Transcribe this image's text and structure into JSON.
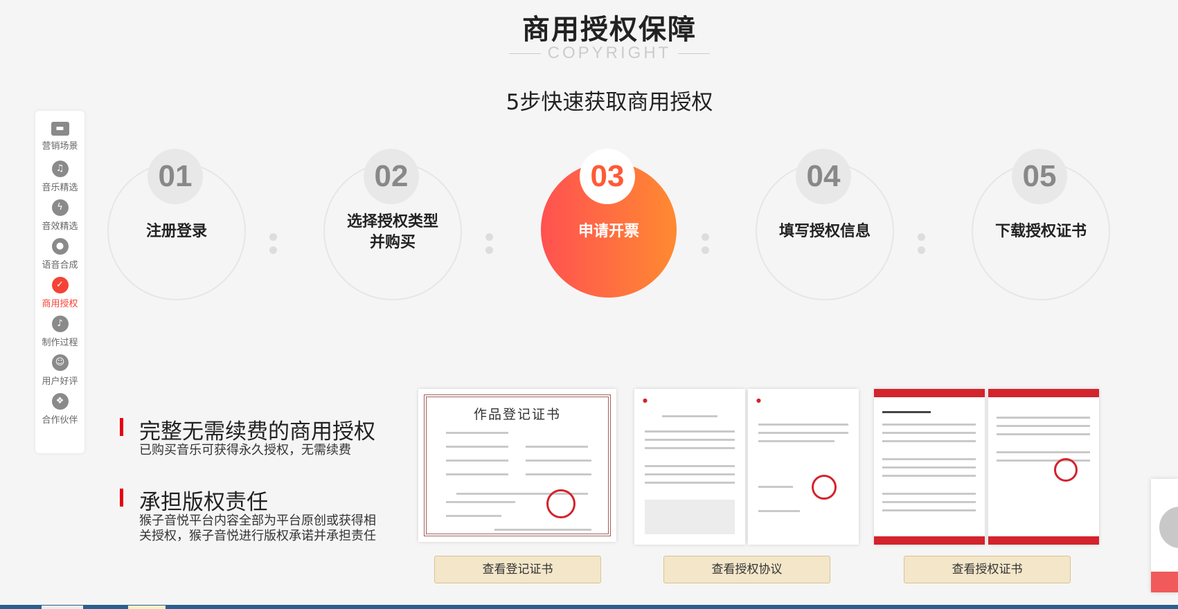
{
  "header": {
    "title": "商用授权保障",
    "subtitle": "COPYRIGHT",
    "steps_title": "5步快速获取商用授权"
  },
  "sidenav": {
    "items": [
      {
        "label": "营销场景",
        "icon": "clapperboard-icon",
        "active": false
      },
      {
        "label": "音乐精选",
        "icon": "music-note-icon",
        "active": false
      },
      {
        "label": "音效精选",
        "icon": "sound-effect-icon",
        "active": false
      },
      {
        "label": "语音合成",
        "icon": "microphone-icon",
        "active": false
      },
      {
        "label": "商用授权",
        "icon": "shield-check-icon",
        "active": true
      },
      {
        "label": "制作过程",
        "icon": "disc-music-icon",
        "active": false
      },
      {
        "label": "用户好评",
        "icon": "smile-icon",
        "active": false
      },
      {
        "label": "合作伙伴",
        "icon": "handshake-icon",
        "active": false
      }
    ]
  },
  "steps": [
    {
      "num": "01",
      "label": "注册登录"
    },
    {
      "num": "02",
      "label": "选择授权类型\n并购买"
    },
    {
      "num": "03",
      "label": "申请开票"
    },
    {
      "num": "04",
      "label": "填写授权信息"
    },
    {
      "num": "05",
      "label": "下载授权证书"
    }
  ],
  "features": [
    {
      "heading": "完整无需续费的商用授权",
      "desc": "已购买音乐可获得永久授权，无需续费"
    },
    {
      "heading": "承担版权责任",
      "desc": "猴子音悦平台内容全部为平台原创或获得相关授权，猴子音悦进行版权承诺并承担责任"
    }
  ],
  "documents": {
    "cert_title": "作品登记证书",
    "buttons": [
      "查看登记证书",
      "查看授权协议",
      "查看授权证书"
    ]
  },
  "colors": {
    "accent": "#f44336",
    "gradient_start": "#ff5151",
    "gradient_end": "#ff8a31",
    "button_bg": "#f3e6c9"
  }
}
